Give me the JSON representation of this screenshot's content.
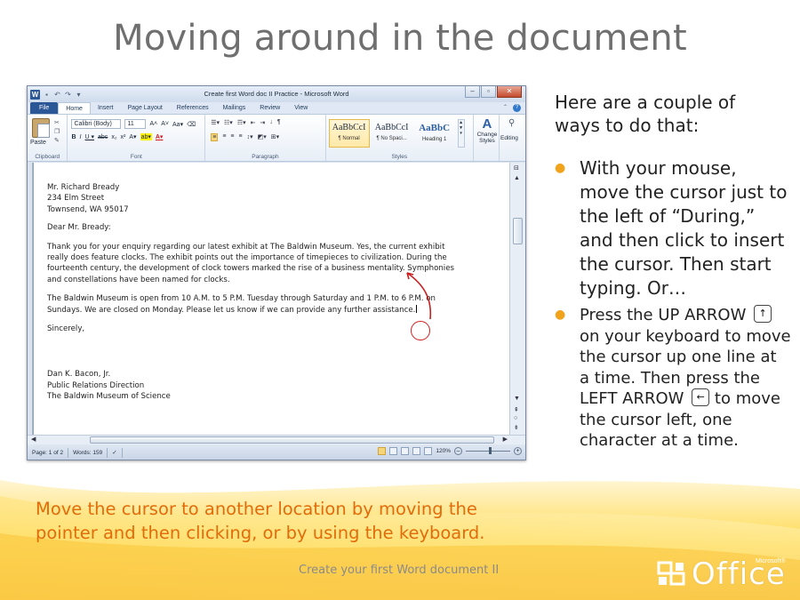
{
  "slide": {
    "title": "Moving around in the document",
    "intro": "Here are a couple of ways to do that:",
    "bullets": [
      "With your mouse, move the cursor just to the left of “During,” and then click to insert the cursor. Then start typing. Or…",
      "Press the UP ARROW",
      "on your keyboard to move the cursor up one line at a time. Then press the LEFT ARROW",
      "to move the cursor left, one character at a time."
    ],
    "caption": "Move the cursor to another location by moving the pointer and then clicking, or by using the keyboard.",
    "footer": "Create your first Word document II",
    "logo": {
      "word": "Office",
      "microsoft": "Microsoft®"
    },
    "colors": {
      "title": "#6f6f6f",
      "caption": "#e36c0a",
      "bullet": "#f0a31b"
    },
    "keys": {
      "up": "up-arrow-key-icon",
      "left": "left-arrow-key-icon"
    }
  },
  "word": {
    "window_title": "Create first Word doc II Practice - Microsoft Word",
    "app_icon": "W",
    "tabs": [
      "File",
      "Home",
      "Insert",
      "Page Layout",
      "References",
      "Mailings",
      "Review",
      "View"
    ],
    "active_tab": "Home",
    "ribbon": {
      "paste": "Paste",
      "clipboard": "Clipboard",
      "font_name": "Calibri (Body)",
      "font_size": "11",
      "font_group": "Font",
      "paragraph_group": "Paragraph",
      "styles_group": "Styles",
      "styles": [
        {
          "sample": "AaBbCcI",
          "name": "¶ Normal"
        },
        {
          "sample": "AaBbCcI",
          "name": "¶ No Spaci..."
        },
        {
          "sample": "AaBbC",
          "name": "Heading 1"
        }
      ],
      "change_styles": "Change Styles",
      "editing": "Editing"
    },
    "document": {
      "address": [
        "Mr. Richard Bready",
        "234 Elm Street",
        "Townsend, WA 95017"
      ],
      "salutation": "Dear Mr. Bready:",
      "paragraph1": "Thank you for your enquiry regarding our latest exhibit at The Baldwin Museum. Yes, the current exhibit really does feature clocks. The exhibit points out the importance of timepieces to civilization. During the fourteenth century, the development of clock towers marked the rise of a business mentality. Symphonies and constellations have been named for clocks.",
      "paragraph2": "The Baldwin Museum is open from 10 A.M. to 5 P.M. Tuesday through Saturday and 1 P.M. to 6 P.M. on Sundays. We are closed on Monday. Please let us know if we can provide any further assistance.",
      "closing": "Sincerely,",
      "signature": [
        "Dan K. Bacon, Jr.",
        "Public Relations Direction",
        "The Baldwin Museum of Science"
      ]
    },
    "status": {
      "page": "Page: 1 of 2",
      "words": "Words: 159",
      "zoom": "120%"
    }
  }
}
